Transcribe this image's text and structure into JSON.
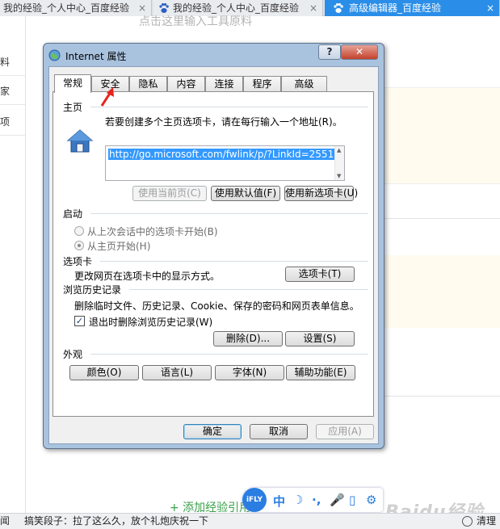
{
  "browser": {
    "tabs": [
      {
        "label": "我的经验_个人中心_百度经验",
        "close": "×"
      },
      {
        "label": "我的经验_个人中心_百度经验",
        "close": "×"
      },
      {
        "label": "高级编辑器_百度经验",
        "close": "×"
      }
    ]
  },
  "page": {
    "placeholder": "点击这里输入工具原料",
    "sidebar": [
      "料",
      "家",
      "项"
    ],
    "add_reference": "+ 添加经验引用",
    "watermark": "Baidu经验"
  },
  "ime": {
    "logo": "iFLY",
    "items": [
      "中",
      "☽",
      "·,",
      "🎤",
      "▯",
      "⚙"
    ]
  },
  "statusbar": {
    "left": "闻",
    "news": "搞笑段子：拉了这么久，放个礼炮庆祝一下",
    "right": "清理"
  },
  "dialog": {
    "title": "Internet 属性",
    "help": "?",
    "close": "✕",
    "tabs": [
      "常规",
      "安全",
      "隐私",
      "内容",
      "连接",
      "程序",
      "高级"
    ],
    "active_tab": "常规",
    "homepage": {
      "header": "主页",
      "instruction": "若要创建多个主页选项卡，请在每行输入一个地址(R)。",
      "url": "http://go.microsoft.com/fwlink/p/?LinkId=2551",
      "btn_current": "使用当前页(C)",
      "btn_default": "使用默认值(F)",
      "btn_newtab": "使用新选项卡(U)"
    },
    "startup": {
      "header": "启动",
      "option1": "从上次会话中的选项卡开始(B)",
      "option2": "从主页开始(H)"
    },
    "tabsgroup": {
      "header": "选项卡",
      "desc": "更改网页在选项卡中的显示方式。",
      "btn": "选项卡(T)"
    },
    "history": {
      "header": "浏览历史记录",
      "desc": "删除临时文件、历史记录、Cookie、保存的密码和网页表单信息。",
      "checkbox": "退出时删除浏览历史记录(W)",
      "btn_delete": "删除(D)...",
      "btn_settings": "设置(S)"
    },
    "appearance": {
      "header": "外观",
      "btn_colors": "颜色(O)",
      "btn_languages": "语言(L)",
      "btn_fonts": "字体(N)",
      "btn_access": "辅助功能(E)"
    },
    "footer": {
      "ok": "确定",
      "cancel": "取消",
      "apply": "应用(A)"
    }
  }
}
